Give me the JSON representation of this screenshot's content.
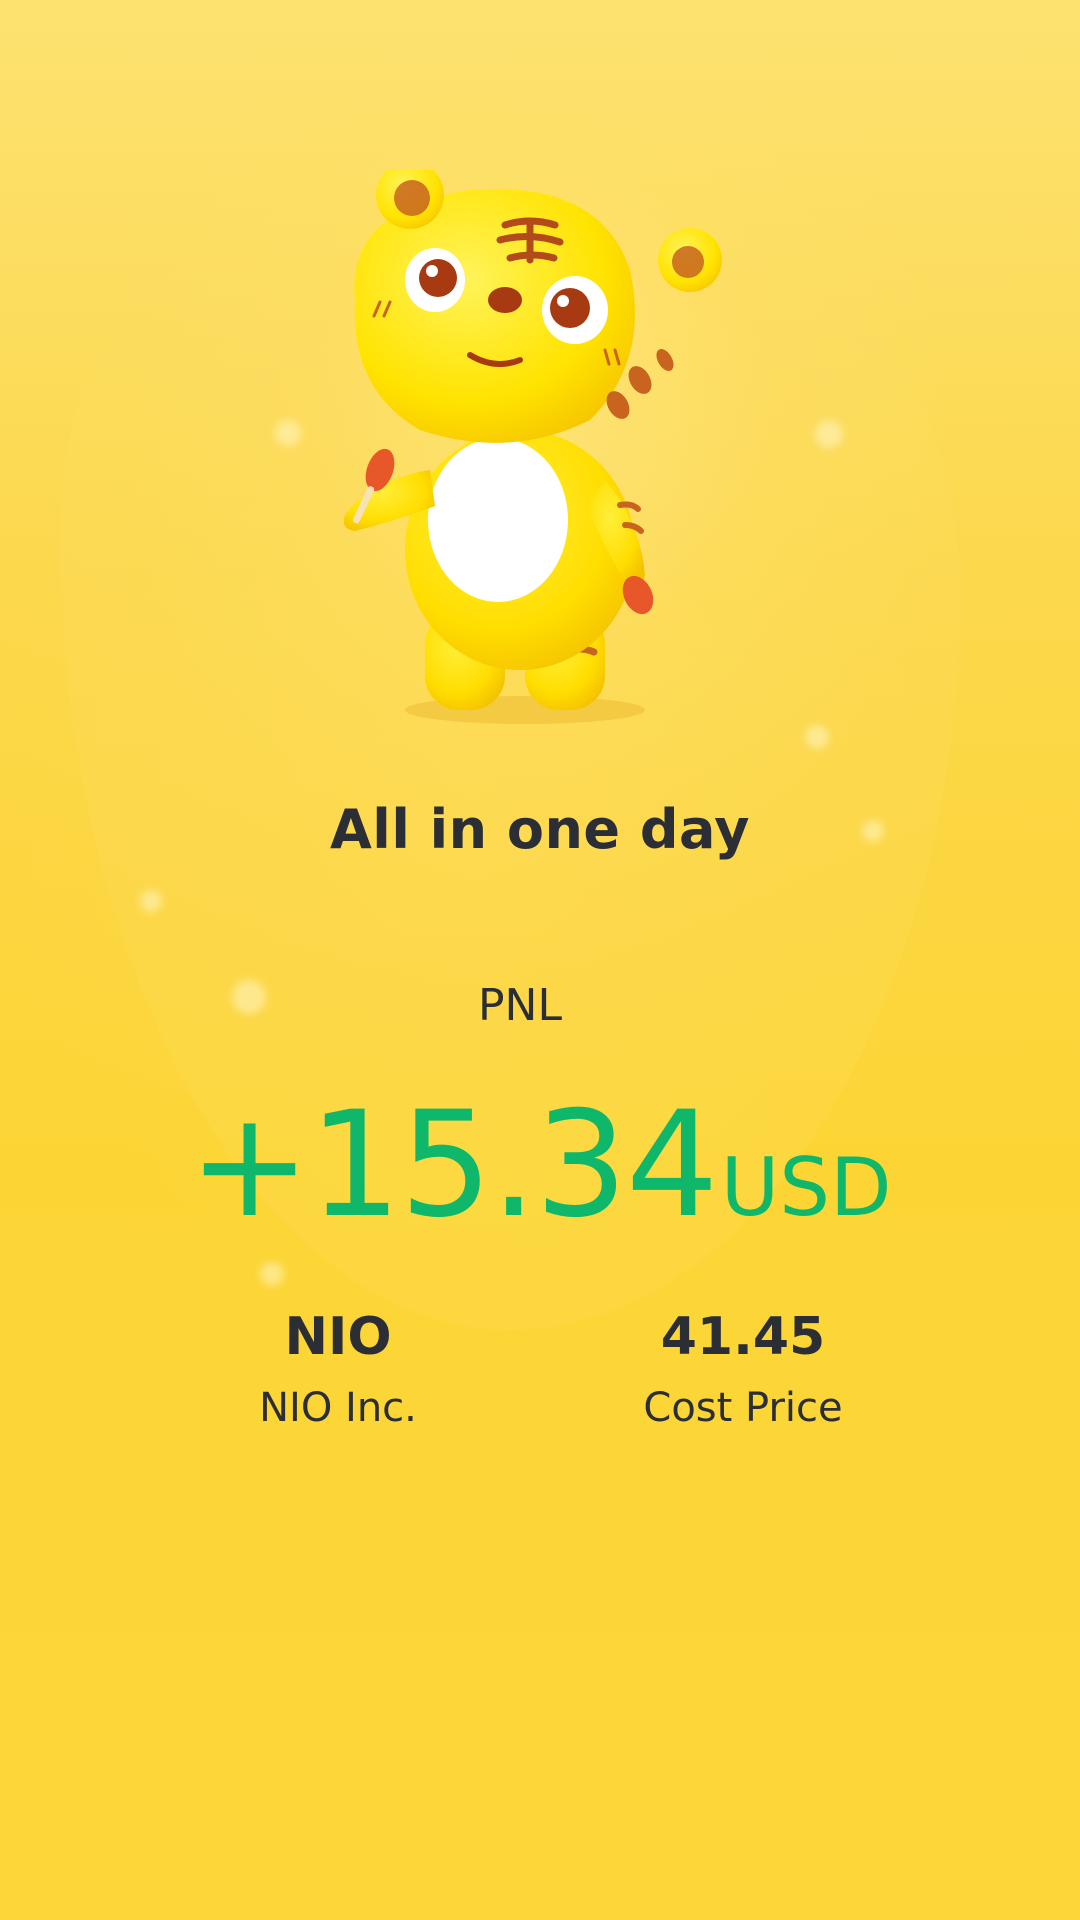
{
  "header": {
    "title": "All in one day"
  },
  "pnl": {
    "label": "PNL",
    "value": "+15.34",
    "currency": "USD"
  },
  "stock": {
    "symbol": "NIO",
    "name": "NIO Inc."
  },
  "cost": {
    "value": "41.45",
    "label": "Cost Price"
  },
  "colors": {
    "background": "#fcd535",
    "text": "#2b2e35",
    "profit": "#0fb76b"
  },
  "icons": {
    "mascot": "tiger-mascot-illustration"
  }
}
